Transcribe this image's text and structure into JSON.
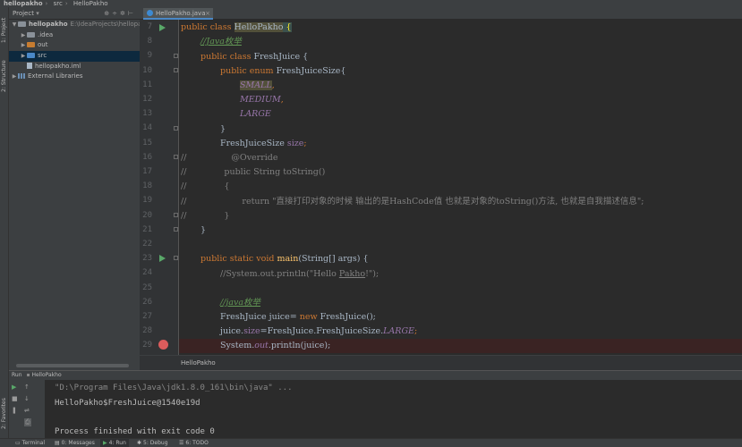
{
  "breadcrumbs": [
    "hellopakho",
    "src",
    "HelloPakho"
  ],
  "side_tabs": {
    "project": "1: Project",
    "structure": "2: Structure",
    "favorites": "2: Favorites"
  },
  "project_panel": {
    "title": "Project",
    "tree": [
      {
        "label": "hellopakho",
        "path": "E:\\IdeaProjects\\hellopakh",
        "icon": "folder-icon"
      },
      {
        "label": ".idea",
        "icon": "folder-icon"
      },
      {
        "label": "out",
        "icon": "folder-icon"
      },
      {
        "label": "src",
        "icon": "folder-icon"
      },
      {
        "label": "hellopakho.iml",
        "icon": "file-icon"
      },
      {
        "label": "External Libraries",
        "icon": "library-icon"
      }
    ]
  },
  "editor": {
    "tab_label": "HelloPakho.java",
    "line_numbers": [
      "7",
      "8",
      "9",
      "10",
      "11",
      "12",
      "13",
      "14",
      "15",
      "16",
      "17",
      "18",
      "19",
      "20",
      "21",
      "22",
      "23",
      "24",
      "25",
      "26",
      "27",
      "28",
      "29"
    ],
    "tokens": {
      "l7_a": "public class ",
      "l7_b": "HelloPakho",
      "l7_c": " {",
      "l8": "//Java枚举",
      "l9_a": "public class ",
      "l9_b": "FreshJuice {",
      "l10_a": "public enum ",
      "l10_b": "FreshJuiceSize{",
      "l11_a": "SMALL",
      "l11_b": ",",
      "l12_a": "MEDIUM",
      "l12_b": ",",
      "l13": "LARGE",
      "l14": "}",
      "l15_a": "FreshJuiceSize ",
      "l15_b": "size",
      "l15_c": ";",
      "l16_a": "//",
      "l16_b": "@Override",
      "l17_a": "//",
      "l17_b": "public String toString()",
      "l18_a": "//",
      "l18_b": "{",
      "l19_a": "//",
      "l19_b": "return \"直接打印对象的时候 输出的是HashCode值 也就是对象的toString()方法, 也就是自我描述信息\";",
      "l20_a": "//",
      "l20_b": "}",
      "l21": "}",
      "l23_a": "public static void ",
      "l23_b": "main",
      "l23_c": "(String[] args) {",
      "l24_a": "//System.out.println(\"Hello ",
      "l24_b": "Pakho",
      "l24_c": "!\");",
      "l26": "//java枚举",
      "l27_a": "FreshJuice juice= ",
      "l27_b": "new ",
      "l27_c": "FreshJuice();",
      "l28_a": "juice.",
      "l28_b": "size",
      "l28_c": "=FreshJuice.FreshJuiceSize.",
      "l28_d": "LARGE",
      "l28_e": ";",
      "l29_a": "System.",
      "l29_b": "out",
      "l29_c": ".println(juice);"
    },
    "status_breadcrumb": "HelloPakho"
  },
  "run_panel": {
    "title": "Run",
    "config": "HelloPakho",
    "console": [
      "\"D:\\Program Files\\Java\\jdk1.8.0_161\\bin\\java\" ...",
      "HelloPakho$FreshJuice@1540e19d",
      "",
      "Process finished with exit code 0"
    ]
  },
  "bottom_tabs": [
    "Terminal",
    "0: Messages",
    "4: Run",
    "5: Debug",
    "6: TODO"
  ],
  "colors": {
    "keyword": "#cc7832",
    "comment": "#808080",
    "string": "#6a8759",
    "static_field": "#9876aa",
    "method": "#ffc66d",
    "run_icon": "#59a869",
    "breakpoint": "#db5c5c"
  }
}
